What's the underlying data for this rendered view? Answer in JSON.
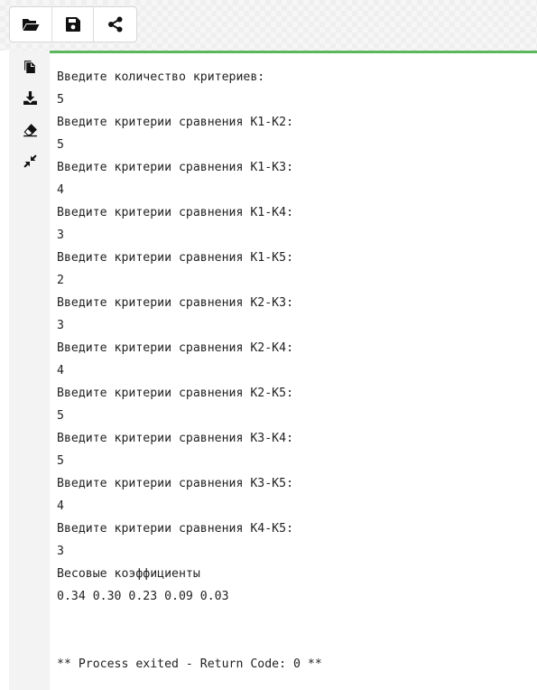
{
  "toolbar": {
    "buttons": [
      {
        "name": "open-folder",
        "icon": "folder-open-icon"
      },
      {
        "name": "save",
        "icon": "floppy-disk-icon"
      },
      {
        "name": "share",
        "icon": "share-icon"
      }
    ]
  },
  "sidebar": {
    "icons": [
      "copy-icon",
      "download-icon",
      "eraser-icon",
      "compress-icon"
    ]
  },
  "output": {
    "lines": [
      "Введите количество критериев:",
      "5",
      "Введите критерии сравнения K1-K2:",
      "5",
      "Введите критерии сравнения K1-K3:",
      "4",
      "Введите критерии сравнения K1-K4:",
      "3",
      "Введите критерии сравнения K1-K5:",
      "2",
      "Введите критерии сравнения K2-K3:",
      "3",
      "Введите критерии сравнения K2-K4:",
      "4",
      "Введите критерии сравнения K2-K5:",
      "5",
      "Введите критерии сравнения K3-K4:",
      "5",
      "Введите критерии сравнения K3-K5:",
      "4",
      "Введите критерии сравнения K4-K5:",
      "3",
      "Весовые коэффициенты",
      "0.34 0.30 0.23 0.09 0.03",
      "",
      "",
      "** Process exited - Return Code: 0 **"
    ]
  },
  "colors": {
    "accent": "#5cb85c",
    "text": "#222222",
    "icon": "#111111"
  }
}
